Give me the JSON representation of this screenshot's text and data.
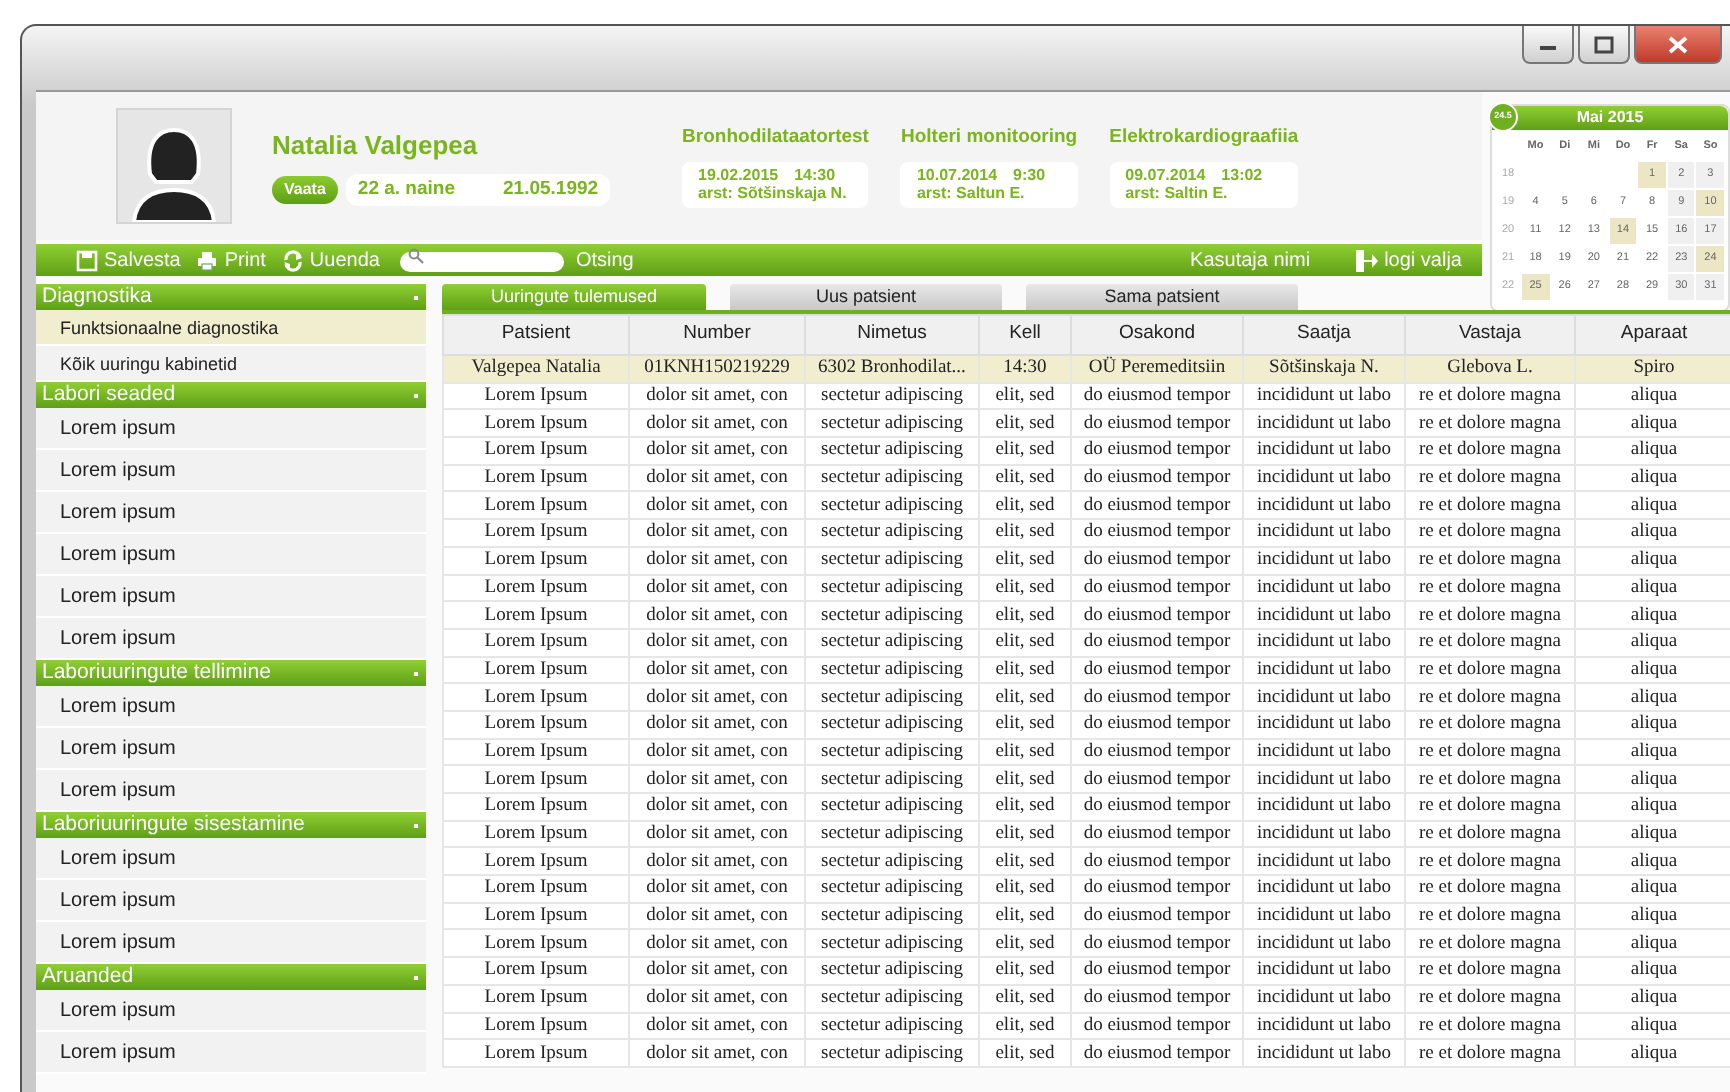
{
  "window": {
    "controls": [
      {
        "kind": "minimize"
      },
      {
        "kind": "maximize"
      },
      {
        "kind": "close"
      }
    ]
  },
  "patient": {
    "name": "Natalia Valgepea",
    "view_button": "Vaata",
    "age_sex": "22 a. naine",
    "birth_date": "21.05.1992"
  },
  "studies": [
    {
      "title": "Bronhodilataatortest",
      "date": "19.02.2015",
      "time": "14:30",
      "doctor": "arst: Sõtšinskaja N."
    },
    {
      "title": "Holteri monitooring",
      "date": "10.07.2014",
      "time": "9:30",
      "doctor": "arst: Saltun E."
    },
    {
      "title": "Elektrokardiograafiia",
      "date": "09.07.2014",
      "time": "13:02",
      "doctor": "arst: Saltin E."
    }
  ],
  "calendar": {
    "badge": "24.5",
    "title": "Mai 2015",
    "weekdays": [
      "Mo",
      "Di",
      "Mi",
      "Do",
      "Fr",
      "Sa",
      "So"
    ],
    "weeks": [
      {
        "week": "18",
        "days": [
          {
            "day": "1",
            "marked": true
          },
          {
            "day": "2",
            "marked": false
          },
          {
            "day": "3",
            "marked": false
          }
        ]
      },
      {
        "week": "19",
        "days": [
          {
            "day": "4",
            "marked": false
          },
          {
            "day": "5",
            "marked": false
          },
          {
            "day": "6",
            "marked": false
          },
          {
            "day": "7",
            "marked": false
          },
          {
            "day": "8",
            "marked": false
          },
          {
            "day": "9",
            "marked": false
          },
          {
            "day": "10",
            "marked": true
          }
        ]
      },
      {
        "week": "20",
        "days": [
          {
            "day": "11",
            "marked": false
          },
          {
            "day": "12",
            "marked": false
          },
          {
            "day": "13",
            "marked": false
          },
          {
            "day": "14",
            "marked": true
          },
          {
            "day": "15",
            "marked": false
          },
          {
            "day": "16",
            "marked": false
          },
          {
            "day": "17",
            "marked": false
          }
        ]
      },
      {
        "week": "21",
        "days": [
          {
            "day": "18",
            "marked": false
          },
          {
            "day": "19",
            "marked": false
          },
          {
            "day": "20",
            "marked": false
          },
          {
            "day": "21",
            "marked": false
          },
          {
            "day": "22",
            "marked": false
          },
          {
            "day": "23",
            "marked": false
          },
          {
            "day": "24",
            "marked": true
          }
        ]
      },
      {
        "week": "22",
        "days": [
          {
            "day": "25",
            "marked": true
          },
          {
            "day": "26",
            "marked": false
          },
          {
            "day": "27",
            "marked": false
          },
          {
            "day": "28",
            "marked": false
          },
          {
            "day": "29",
            "marked": false
          },
          {
            "day": "30",
            "marked": false
          },
          {
            "day": "31",
            "marked": false
          }
        ]
      }
    ]
  },
  "toolbar": {
    "items": [
      {
        "kind": "save",
        "label": "Salvesta"
      },
      {
        "kind": "print",
        "label": "Print"
      },
      {
        "kind": "refresh",
        "label": "Uuenda"
      }
    ],
    "search_button": "Otsing",
    "user": "Kasutaja nimi",
    "logout": "logi valja"
  },
  "sidebar": {
    "sections": [
      {
        "title": "Diagnostika",
        "items": [
          {
            "label": "Funktsionaalne diagnostika",
            "selected": true
          },
          {
            "label": "Kõik uuringu kabinetid",
            "selected": false
          }
        ]
      },
      {
        "title": "Labori seaded",
        "items": [
          {
            "label": "Lorem ipsum",
            "selected": false
          },
          {
            "label": "Lorem ipsum",
            "selected": false
          },
          {
            "label": "Lorem ipsum",
            "selected": false
          },
          {
            "label": "Lorem ipsum",
            "selected": false
          },
          {
            "label": "Lorem ipsum",
            "selected": false
          },
          {
            "label": "Lorem ipsum",
            "selected": false
          }
        ]
      },
      {
        "title": "Laboriuuringute tellimine",
        "items": [
          {
            "label": "Lorem ipsum",
            "selected": false
          },
          {
            "label": "Lorem ipsum",
            "selected": false
          },
          {
            "label": "Lorem ipsum",
            "selected": false
          }
        ]
      },
      {
        "title": "Laboriuuringute sisestamine",
        "items": [
          {
            "label": "Lorem ipsum",
            "selected": false
          },
          {
            "label": "Lorem ipsum",
            "selected": false
          },
          {
            "label": "Lorem ipsum",
            "selected": false
          }
        ]
      },
      {
        "title": "Aruanded",
        "items": [
          {
            "label": "Lorem ipsum",
            "selected": false
          },
          {
            "label": "Lorem ipsum",
            "selected": false
          }
        ]
      }
    ]
  },
  "tabs": [
    {
      "label": "Uuringute tulemused",
      "selected": true
    },
    {
      "label": "Uus patsient",
      "selected": false
    },
    {
      "label": "Sama patsient",
      "selected": false
    }
  ],
  "table": {
    "columns": [
      "Patsient",
      "Number",
      "Nimetus",
      "Kell",
      "Osakond",
      "Saatja",
      "Vastaja",
      "Aparaat"
    ],
    "rows": [
      {
        "selected": true,
        "cells": [
          "Valgepea Natalia",
          "01KNH150219229",
          "6302 Bronhodilat...",
          "14:30",
          "OÜ Peremeditsiin",
          "Sõtšinskaja N.",
          "Glebova L.",
          "Spiro"
        ]
      },
      {
        "selected": false,
        "cells": [
          "Lorem Ipsum",
          "dolor sit amet, con",
          "sectetur adipiscing",
          "elit, sed",
          "do eiusmod tempor",
          "incididunt ut labo",
          "re et dolore magna",
          "aliqua"
        ]
      },
      {
        "selected": false,
        "cells": [
          "Lorem Ipsum",
          "dolor sit amet, con",
          "sectetur adipiscing",
          "elit, sed",
          "do eiusmod tempor",
          "incididunt ut labo",
          "re et dolore magna",
          "aliqua"
        ]
      },
      {
        "selected": false,
        "cells": [
          "Lorem Ipsum",
          "dolor sit amet, con",
          "sectetur adipiscing",
          "elit, sed",
          "do eiusmod tempor",
          "incididunt ut labo",
          "re et dolore magna",
          "aliqua"
        ]
      },
      {
        "selected": false,
        "cells": [
          "Lorem Ipsum",
          "dolor sit amet, con",
          "sectetur adipiscing",
          "elit, sed",
          "do eiusmod tempor",
          "incididunt ut labo",
          "re et dolore magna",
          "aliqua"
        ]
      },
      {
        "selected": false,
        "cells": [
          "Lorem Ipsum",
          "dolor sit amet, con",
          "sectetur adipiscing",
          "elit, sed",
          "do eiusmod tempor",
          "incididunt ut labo",
          "re et dolore magna",
          "aliqua"
        ]
      },
      {
        "selected": false,
        "cells": [
          "Lorem Ipsum",
          "dolor sit amet, con",
          "sectetur adipiscing",
          "elit, sed",
          "do eiusmod tempor",
          "incididunt ut labo",
          "re et dolore magna",
          "aliqua"
        ]
      },
      {
        "selected": false,
        "cells": [
          "Lorem Ipsum",
          "dolor sit amet, con",
          "sectetur adipiscing",
          "elit, sed",
          "do eiusmod tempor",
          "incididunt ut labo",
          "re et dolore magna",
          "aliqua"
        ]
      },
      {
        "selected": false,
        "cells": [
          "Lorem Ipsum",
          "dolor sit amet, con",
          "sectetur adipiscing",
          "elit, sed",
          "do eiusmod tempor",
          "incididunt ut labo",
          "re et dolore magna",
          "aliqua"
        ]
      },
      {
        "selected": false,
        "cells": [
          "Lorem Ipsum",
          "dolor sit amet, con",
          "sectetur adipiscing",
          "elit, sed",
          "do eiusmod tempor",
          "incididunt ut labo",
          "re et dolore magna",
          "aliqua"
        ]
      },
      {
        "selected": false,
        "cells": [
          "Lorem Ipsum",
          "dolor sit amet, con",
          "sectetur adipiscing",
          "elit, sed",
          "do eiusmod tempor",
          "incididunt ut labo",
          "re et dolore magna",
          "aliqua"
        ]
      },
      {
        "selected": false,
        "cells": [
          "Lorem Ipsum",
          "dolor sit amet, con",
          "sectetur adipiscing",
          "elit, sed",
          "do eiusmod tempor",
          "incididunt ut labo",
          "re et dolore magna",
          "aliqua"
        ]
      },
      {
        "selected": false,
        "cells": [
          "Lorem Ipsum",
          "dolor sit amet, con",
          "sectetur adipiscing",
          "elit, sed",
          "do eiusmod tempor",
          "incididunt ut labo",
          "re et dolore magna",
          "aliqua"
        ]
      },
      {
        "selected": false,
        "cells": [
          "Lorem Ipsum",
          "dolor sit amet, con",
          "sectetur adipiscing",
          "elit, sed",
          "do eiusmod tempor",
          "incididunt ut labo",
          "re et dolore magna",
          "aliqua"
        ]
      },
      {
        "selected": false,
        "cells": [
          "Lorem Ipsum",
          "dolor sit amet, con",
          "sectetur adipiscing",
          "elit, sed",
          "do eiusmod tempor",
          "incididunt ut labo",
          "re et dolore magna",
          "aliqua"
        ]
      },
      {
        "selected": false,
        "cells": [
          "Lorem Ipsum",
          "dolor sit amet, con",
          "sectetur adipiscing",
          "elit, sed",
          "do eiusmod tempor",
          "incididunt ut labo",
          "re et dolore magna",
          "aliqua"
        ]
      },
      {
        "selected": false,
        "cells": [
          "Lorem Ipsum",
          "dolor sit amet, con",
          "sectetur adipiscing",
          "elit, sed",
          "do eiusmod tempor",
          "incididunt ut labo",
          "re et dolore magna",
          "aliqua"
        ]
      },
      {
        "selected": false,
        "cells": [
          "Lorem Ipsum",
          "dolor sit amet, con",
          "sectetur adipiscing",
          "elit, sed",
          "do eiusmod tempor",
          "incididunt ut labo",
          "re et dolore magna",
          "aliqua"
        ]
      },
      {
        "selected": false,
        "cells": [
          "Lorem Ipsum",
          "dolor sit amet, con",
          "sectetur adipiscing",
          "elit, sed",
          "do eiusmod tempor",
          "incididunt ut labo",
          "re et dolore magna",
          "aliqua"
        ]
      },
      {
        "selected": false,
        "cells": [
          "Lorem Ipsum",
          "dolor sit amet, con",
          "sectetur adipiscing",
          "elit, sed",
          "do eiusmod tempor",
          "incididunt ut labo",
          "re et dolore magna",
          "aliqua"
        ]
      },
      {
        "selected": false,
        "cells": [
          "Lorem Ipsum",
          "dolor sit amet, con",
          "sectetur adipiscing",
          "elit, sed",
          "do eiusmod tempor",
          "incididunt ut labo",
          "re et dolore magna",
          "aliqua"
        ]
      },
      {
        "selected": false,
        "cells": [
          "Lorem Ipsum",
          "dolor sit amet, con",
          "sectetur adipiscing",
          "elit, sed",
          "do eiusmod tempor",
          "incididunt ut labo",
          "re et dolore magna",
          "aliqua"
        ]
      },
      {
        "selected": false,
        "cells": [
          "Lorem Ipsum",
          "dolor sit amet, con",
          "sectetur adipiscing",
          "elit, sed",
          "do eiusmod tempor",
          "incididunt ut labo",
          "re et dolore magna",
          "aliqua"
        ]
      },
      {
        "selected": false,
        "cells": [
          "Lorem Ipsum",
          "dolor sit amet, con",
          "sectetur adipiscing",
          "elit, sed",
          "do eiusmod tempor",
          "incididunt ut labo",
          "re et dolore magna",
          "aliqua"
        ]
      },
      {
        "selected": false,
        "cells": [
          "Lorem Ipsum",
          "dolor sit amet, con",
          "sectetur adipiscing",
          "elit, sed",
          "do eiusmod tempor",
          "incididunt ut labo",
          "re et dolore magna",
          "aliqua"
        ]
      },
      {
        "selected": false,
        "cells": [
          "Lorem Ipsum",
          "dolor sit amet, con",
          "sectetur adipiscing",
          "elit, sed",
          "do eiusmod tempor",
          "incididunt ut labo",
          "re et dolore magna",
          "aliqua"
        ]
      }
    ]
  }
}
